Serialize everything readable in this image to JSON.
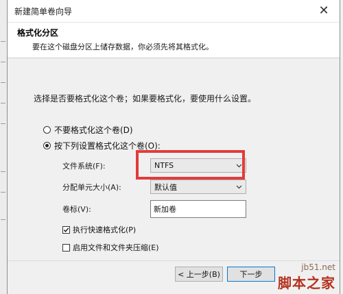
{
  "window": {
    "title": "新建简单卷向导",
    "close_glyph": "✕"
  },
  "header": {
    "title": "格式化分区",
    "subtitle": "要在这个磁盘分区上储存数据，你必须先将其格式化。"
  },
  "body": {
    "prompt": "选择是否要格式化这个卷；如果要格式化，要使用什么设置。",
    "radio_no_format": "不要格式化这个卷(D)",
    "radio_format": "按下列设置格式化这个卷(O):",
    "selected_radio": "format"
  },
  "fields": {
    "filesystem_label": "文件系统(F):",
    "filesystem_value": "NTFS",
    "allocation_label": "分配单元大小(A):",
    "allocation_value": "默认值",
    "volume_label_label": "卷标(V):",
    "volume_label_value": "新加卷"
  },
  "options": {
    "quick_format_label": "执行快速格式化(P)",
    "quick_format_checked": true,
    "compression_label": "启用文件和文件夹压缩(E)",
    "compression_checked": false
  },
  "footer": {
    "back_label": "< 上一步(B)",
    "next_label": "下一步"
  },
  "watermark": {
    "line1": "jb51.net",
    "line2": "脚本之家"
  },
  "colors": {
    "highlight": "#e23b3b",
    "window_bg": "#f0f0f0",
    "header_bg": "#ffffff",
    "accent": "#0078d7"
  },
  "icons": [
    "close-icon",
    "chevron-down-icon",
    "checkmark-icon"
  ]
}
